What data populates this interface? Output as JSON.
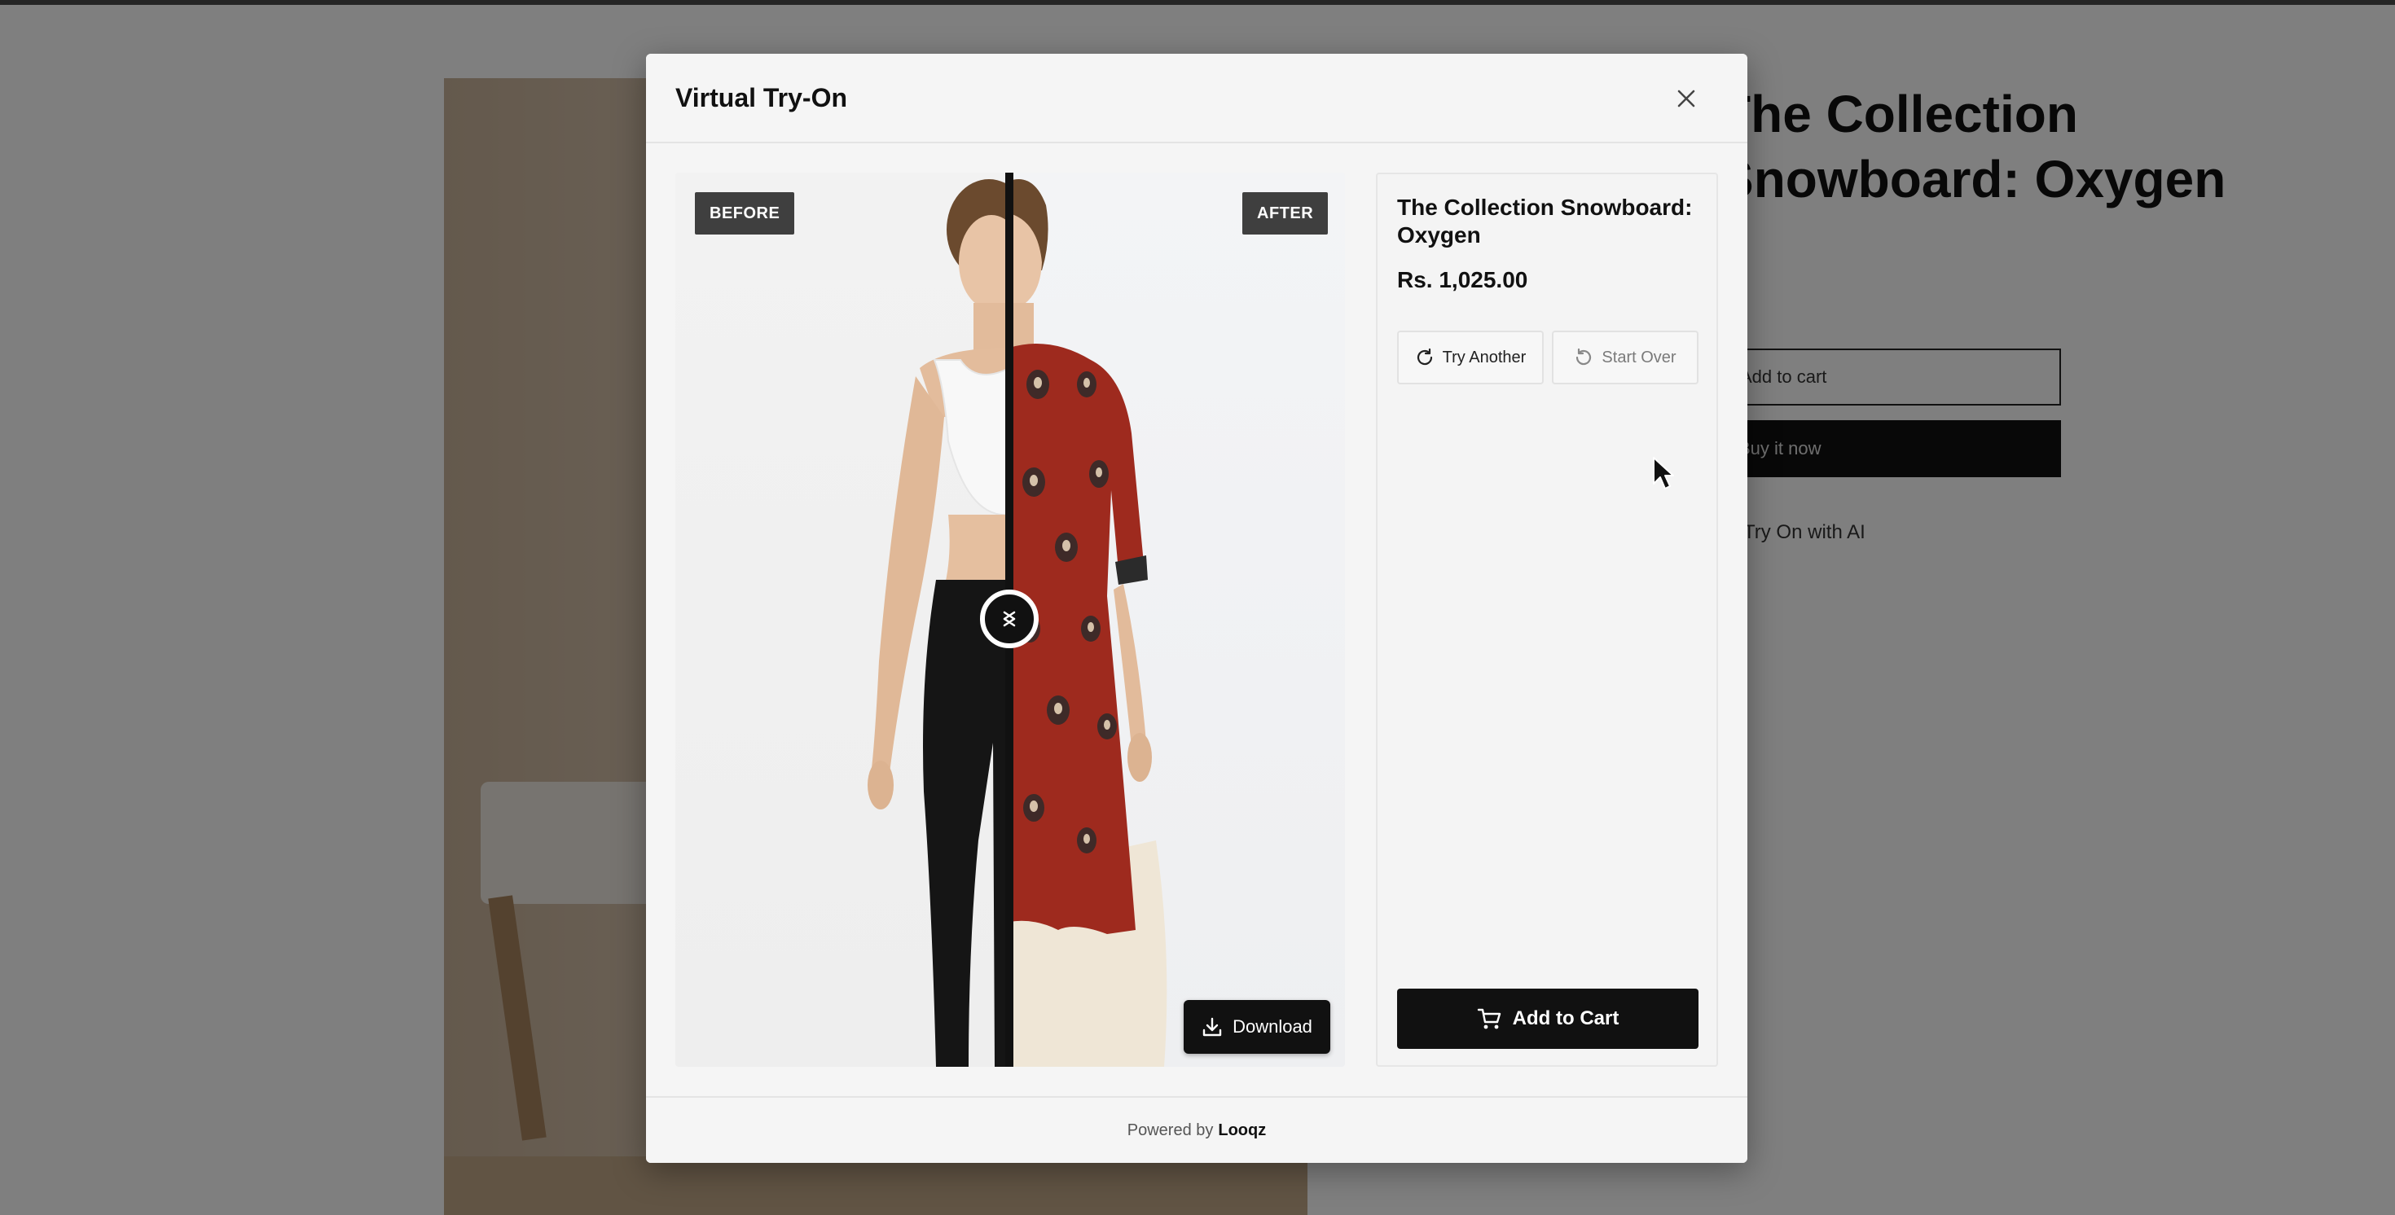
{
  "background_page": {
    "title_line1": "The Collection",
    "title_line2": "Snowboard: Oxygen",
    "add_to_cart_label": "Add to cart",
    "buy_now_label": "Buy it now",
    "try_on_link": "Try On with AI"
  },
  "modal": {
    "title": "Virtual Try-On",
    "close_icon": "close-icon",
    "compare": {
      "before_label": "BEFORE",
      "after_label": "AFTER",
      "divider_position": 0.5,
      "download_label": "Download"
    },
    "product": {
      "title": "The Collection Snowboard: Oxygen",
      "price": "Rs. 1,025.00"
    },
    "actions": {
      "try_another_label": "Try Another",
      "start_over_label": "Start Over",
      "add_to_cart_label": "Add to Cart"
    },
    "footer": {
      "powered_by": "Powered by",
      "brand": "Looqz"
    }
  },
  "colors": {
    "overlay": "#7f7f7f",
    "modal_bg": "#f5f5f5",
    "primary_button": "#111111",
    "tag_bg": "#3f3f3f",
    "kurta_red": "#9e2a1e"
  }
}
